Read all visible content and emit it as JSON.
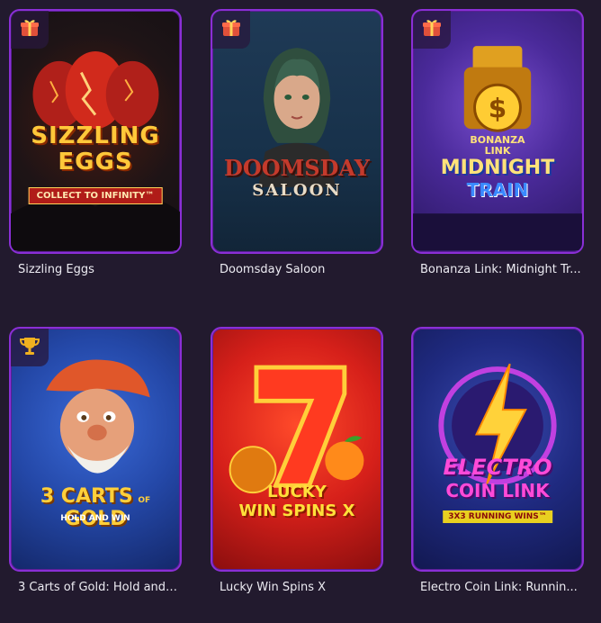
{
  "games": [
    {
      "title": "Sizzling Eggs",
      "badge_icon": "gift-icon",
      "logo_lines": [
        "SIZZLING",
        "EGGS"
      ],
      "tagline": "COLLECT TO INFINITY™"
    },
    {
      "title": "Doomsday Saloon",
      "badge_icon": "gift-icon",
      "logo_lines": [
        "DOOMSDAY",
        "SALOON"
      ]
    },
    {
      "title": "Bonanza Link: Midnight Tr...",
      "badge_icon": "gift-icon",
      "logo_lines": [
        "BONANZA",
        "LINK",
        "MIDNIGHT",
        "TRAIN"
      ]
    },
    {
      "title": "3 Carts of Gold: Hold and ...",
      "badge_icon": "trophy-icon",
      "logo_lines": [
        "3 CARTS",
        "OF",
        "GOLD"
      ],
      "tagline": "HOLD AND WIN"
    },
    {
      "title": "Lucky Win Spins X",
      "logo_lines": [
        "LUCKY",
        "WIN SPINS X"
      ]
    },
    {
      "title": "Electro Coin Link: Runnin...",
      "logo_lines": [
        "ELECTRO",
        "COIN LINK"
      ],
      "tagline": "3X3 RUNNING WINS™"
    }
  ],
  "colors": {
    "background": "#221a2e",
    "card_border": "#8a2fd6",
    "title_text": "#ecebf2"
  }
}
